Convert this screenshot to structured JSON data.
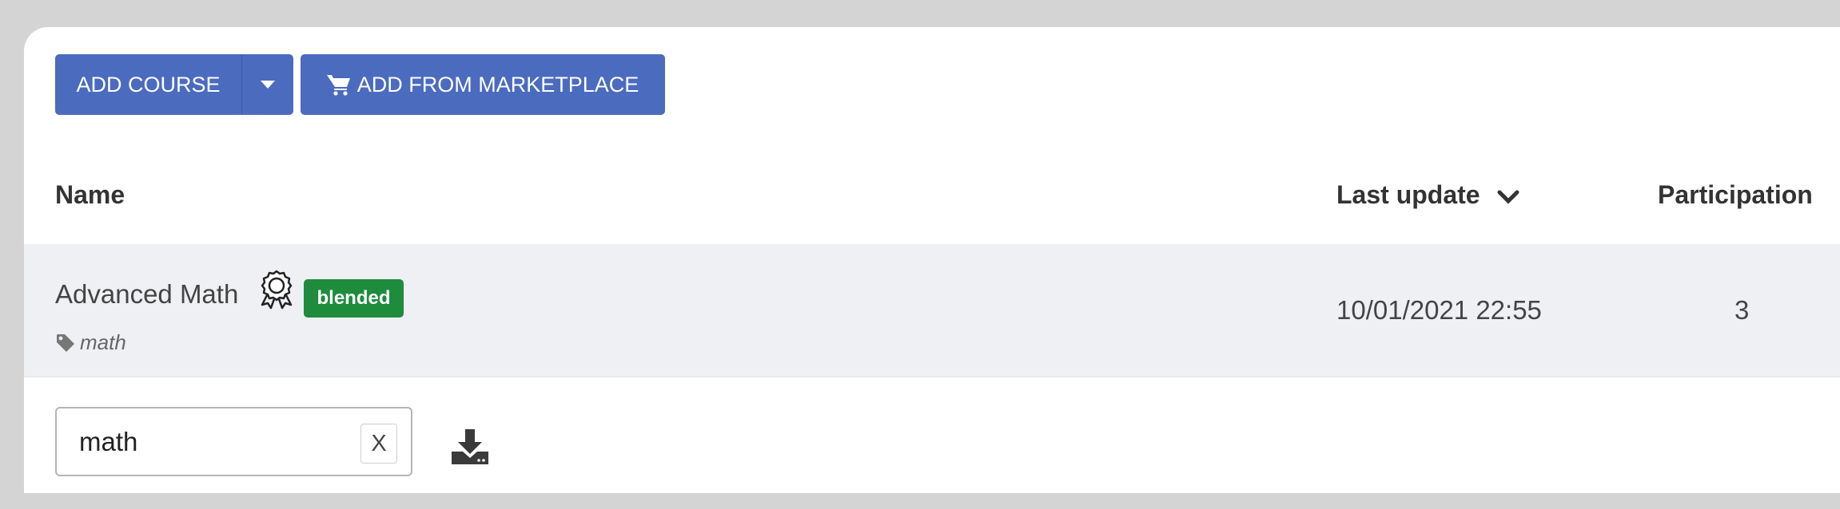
{
  "toolbar": {
    "add_course_label": "ADD COURSE",
    "add_marketplace_label": "ADD FROM MARKETPLACE"
  },
  "table": {
    "columns": {
      "name": "Name",
      "last_update": "Last update",
      "participation": "Participation"
    },
    "rows": [
      {
        "name": "Advanced Math",
        "badge": "blended",
        "tag": "math",
        "last_update": "10/01/2021 22:55",
        "participation": "3"
      }
    ]
  },
  "search": {
    "value": "math",
    "clear_label": "X"
  },
  "colors": {
    "primary": "#4b6bbf",
    "badge_green": "#1e8c3c",
    "row_bg": "#eef0f4"
  },
  "icons": {
    "cart": "cart-icon",
    "caret": "caret-down-icon",
    "sort": "chevron-down-icon",
    "medal": "certificate-icon",
    "tag": "tag-icon",
    "download": "download-icon"
  }
}
